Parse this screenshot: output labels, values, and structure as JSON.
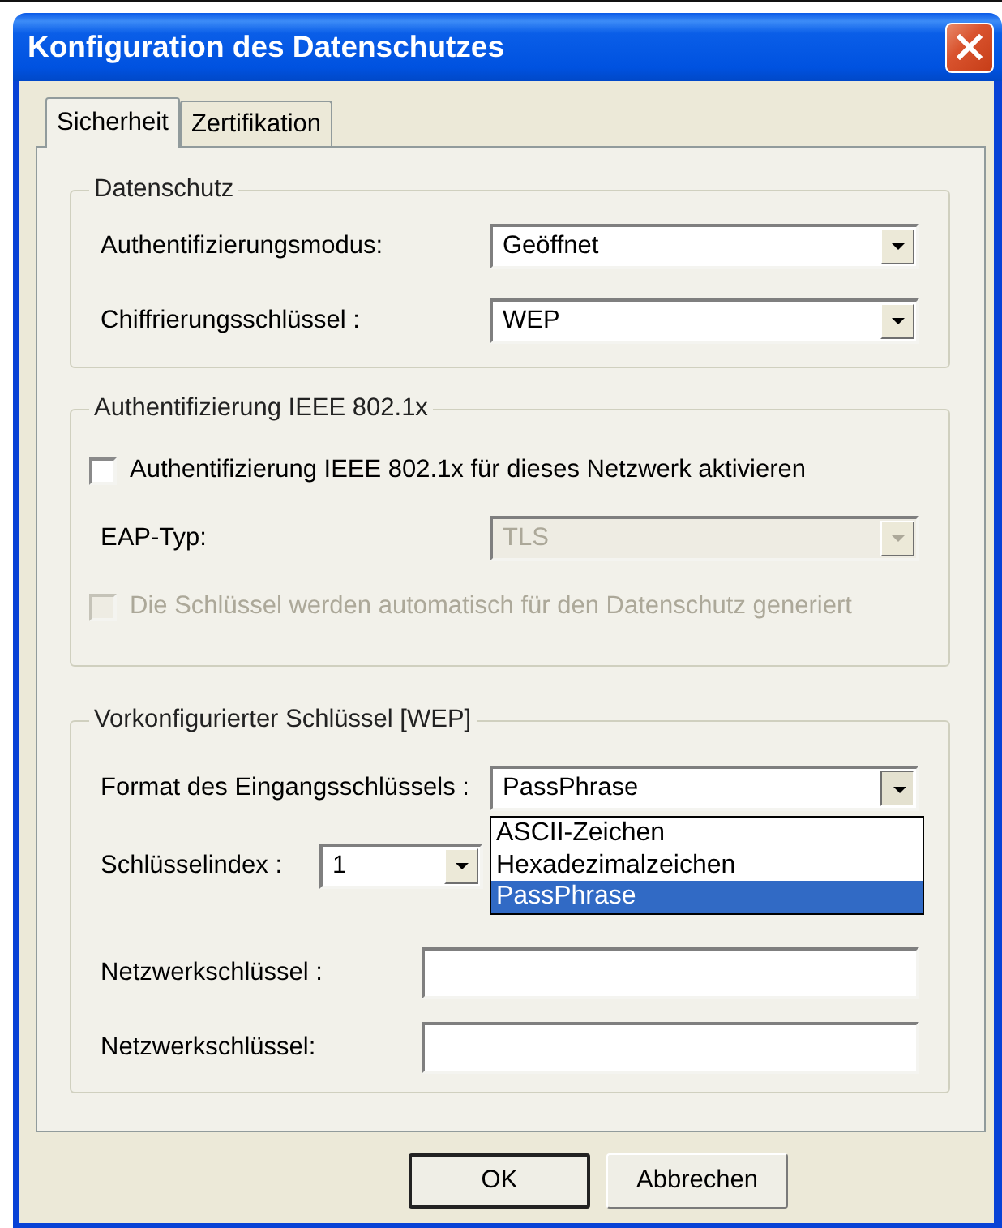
{
  "window": {
    "title": "Konfiguration des Datenschutzes"
  },
  "tabs": [
    {
      "label": "Sicherheit",
      "selected": true
    },
    {
      "label": "Zertifikation",
      "selected": false
    }
  ],
  "groups": [
    {
      "title": "Datenschutz",
      "rows": [
        {
          "kind": "combo",
          "label": "Authentifizierungsmodus:",
          "value": "Geöffnet",
          "disabled": false
        },
        {
          "kind": "combo",
          "label": "Chiffrierungsschlüssel :",
          "value": "WEP",
          "disabled": false
        }
      ]
    },
    {
      "title": "Authentifizierung IEEE 802.1x",
      "rows": [
        {
          "kind": "checkbox",
          "label": "Authentifizierung IEEE 802.1x für dieses Netzwerk aktivieren",
          "checked": false,
          "disabled": false
        },
        {
          "kind": "combo",
          "label": "EAP-Typ:",
          "value": "TLS",
          "disabled": true
        },
        {
          "kind": "checkbox",
          "label": "Die Schlüssel werden automatisch für den Datenschutz generiert",
          "checked": false,
          "disabled": true
        }
      ]
    },
    {
      "title": "Vorkonfigurierter Schlüssel [WEP]",
      "rows": [
        {
          "kind": "combo",
          "label": "Format des Eingangsschlüssels :",
          "value": "PassPhrase",
          "disabled": false,
          "expanded": true,
          "options": [
            {
              "label": "ASCII-Zeichen",
              "selected": false
            },
            {
              "label": "Hexadezimalzeichen",
              "selected": false
            },
            {
              "label": "PassPhrase",
              "selected": true
            }
          ]
        },
        {
          "kind": "short_combo",
          "label": "Schlüsselindex :",
          "value": "1",
          "disabled": false
        },
        {
          "kind": "text",
          "label": "Netzwerkschlüssel :"
        },
        {
          "kind": "text",
          "label": "Netzwerkschlüssel:"
        }
      ]
    }
  ],
  "buttons": [
    {
      "label": "OK",
      "default": true
    },
    {
      "label": "Abbrechen",
      "default": false
    }
  ]
}
